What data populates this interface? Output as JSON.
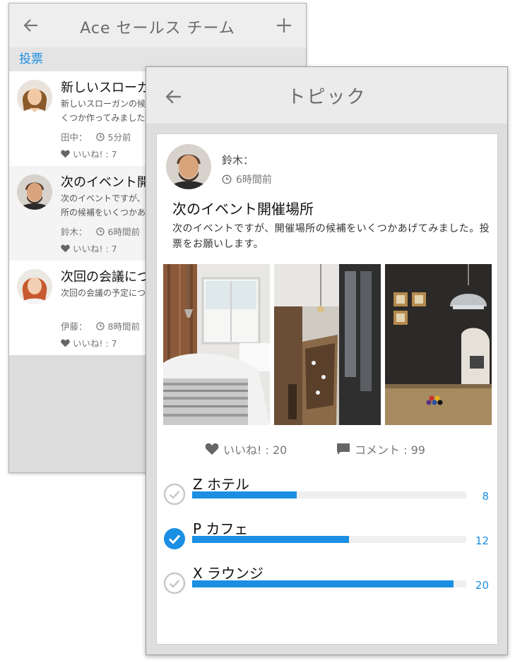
{
  "back_screen": {
    "header": {
      "title": "Ace セールス チーム",
      "back_icon": "arrow-left-icon",
      "add_icon": "plus-icon"
    },
    "section_label": "投票",
    "posts": [
      {
        "title": "新しいスローガン",
        "body": "新しいスローガンの候補をいくつか作ってみました。投票をお願いし",
        "author": "田中：",
        "time": "5分前",
        "likes": "いいね! : 7"
      },
      {
        "title": "次のイベント開",
        "body": "次のイベントですが、開催場所の候補をいくつかあげてみました。",
        "author": "鈴木：",
        "time": "6時間前",
        "likes": "いいね! : 7"
      },
      {
        "title": "次回の会議につ",
        "body": "次回の会議の予定について",
        "author": "伊藤：",
        "time": "8時間前",
        "likes": "いいね! : 7"
      }
    ]
  },
  "front_screen": {
    "header": {
      "title": "トピック",
      "back_icon": "arrow-left-icon"
    },
    "topic": {
      "author": "鈴木：",
      "time": "6時間前",
      "title": "次のイベント開催場所",
      "body": "次のイベントですが、開催場所の候補をいくつかあげてみました。投票をお願いします。",
      "likes": "いいね! : 20",
      "comments": "コメント : 99"
    },
    "poll_options": [
      {
        "label": "Z ホテル",
        "count": "8",
        "votes": 8,
        "checked": false
      },
      {
        "label": "P カフェ",
        "count": "12",
        "votes": 12,
        "checked": true
      },
      {
        "label": "X ラウンジ",
        "count": "20",
        "votes": 20,
        "checked": false
      }
    ],
    "poll_max": 21
  },
  "colors": {
    "accent": "#1a8fe3",
    "header_bg": "#ebebeb",
    "muted_text": "#777777"
  }
}
